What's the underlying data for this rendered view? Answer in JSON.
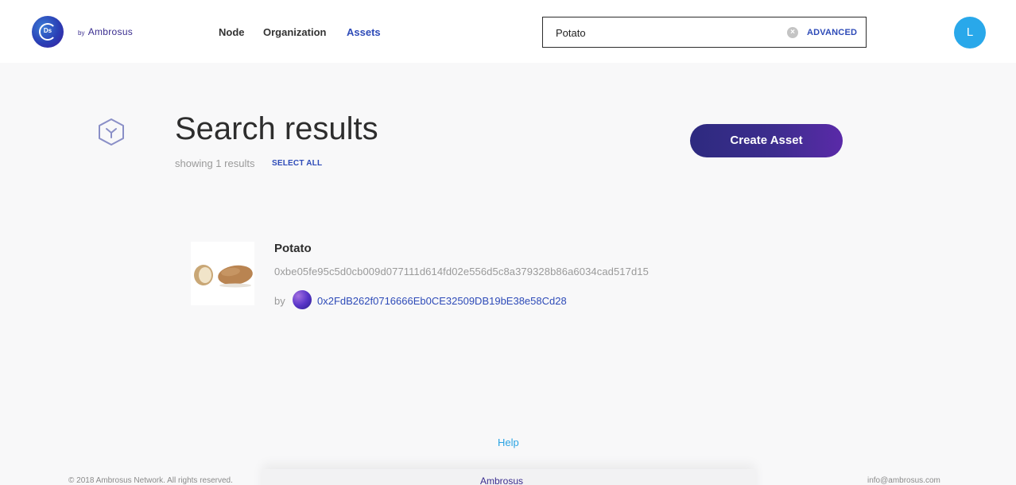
{
  "header": {
    "logo_mark": "Ds",
    "by_text": "by",
    "brand_name": "Ambrosus",
    "nav": [
      {
        "label": "Node",
        "active": false
      },
      {
        "label": "Organization",
        "active": false
      },
      {
        "label": "Assets",
        "active": true
      }
    ],
    "search": {
      "value": "Potato",
      "clear_icon": "clear-icon",
      "advanced_label": "ADVANCED"
    },
    "user_initial": "L"
  },
  "main": {
    "section_icon": "cube-icon",
    "title": "Search results",
    "results_count": "showing 1 results",
    "select_all_label": "SELECT ALL",
    "create_button_label": "Create Asset",
    "results": [
      {
        "name": "Potato",
        "hash": "0xbe05fe95c5d0cb009d077111d614fd02e556d5c8a379328b86a6034cad517d15",
        "by_label": "by",
        "owner_address": "0x2FdB262f0716666Eb0CE32509DB19bE38e58Cd28"
      }
    ]
  },
  "footer": {
    "help_label": "Help",
    "copyright": "© 2018 Ambrosus Network. All rights reserved.",
    "logo_text": "Ambrosus",
    "email": "info@ambrosus.com"
  },
  "colors": {
    "accent_blue": "#2e4bb8",
    "button_gradient_start": "#2d2a7f",
    "button_gradient_end": "#5a2aa8",
    "avatar": "#29a8ea",
    "help_link": "#2aa3e3"
  }
}
